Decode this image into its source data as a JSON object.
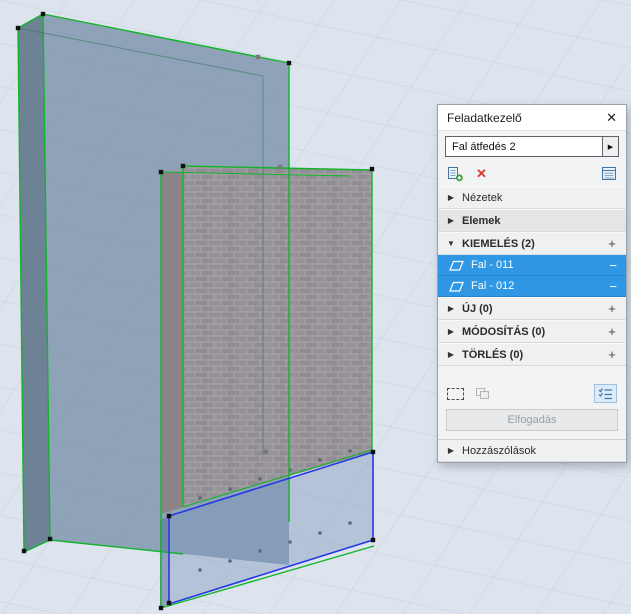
{
  "viewport": {
    "selected_elements": [
      "Fal - 011",
      "Fal - 012"
    ],
    "colors": {
      "selection_green": "#12b42a",
      "selection_blue": "#2438e4",
      "list_selection_blue": "#2f97e3",
      "delete_red": "#d43b30",
      "background": "#dde4ee"
    }
  },
  "panel": {
    "title": "Feladatkezelő",
    "task_selector_value": "Fal átfedés 2",
    "sections": {
      "views": "Nézetek",
      "elements": "Elemek",
      "highlight": "KIEMELÉS (2)",
      "new": "ÚJ (0)",
      "modify": "MÓDOSÍTÁS (0)",
      "delete": "TÖRLÉS (0)",
      "comments": "Hozzászólások"
    },
    "items": [
      {
        "label": "Fal - 011"
      },
      {
        "label": "Fal - 012"
      }
    ],
    "accept_label": "Elfogadás"
  },
  "icons": {
    "close": "✕",
    "collapsed": "▶",
    "expanded": "▼",
    "plus": "+",
    "minus": "−",
    "delete": "✕"
  }
}
